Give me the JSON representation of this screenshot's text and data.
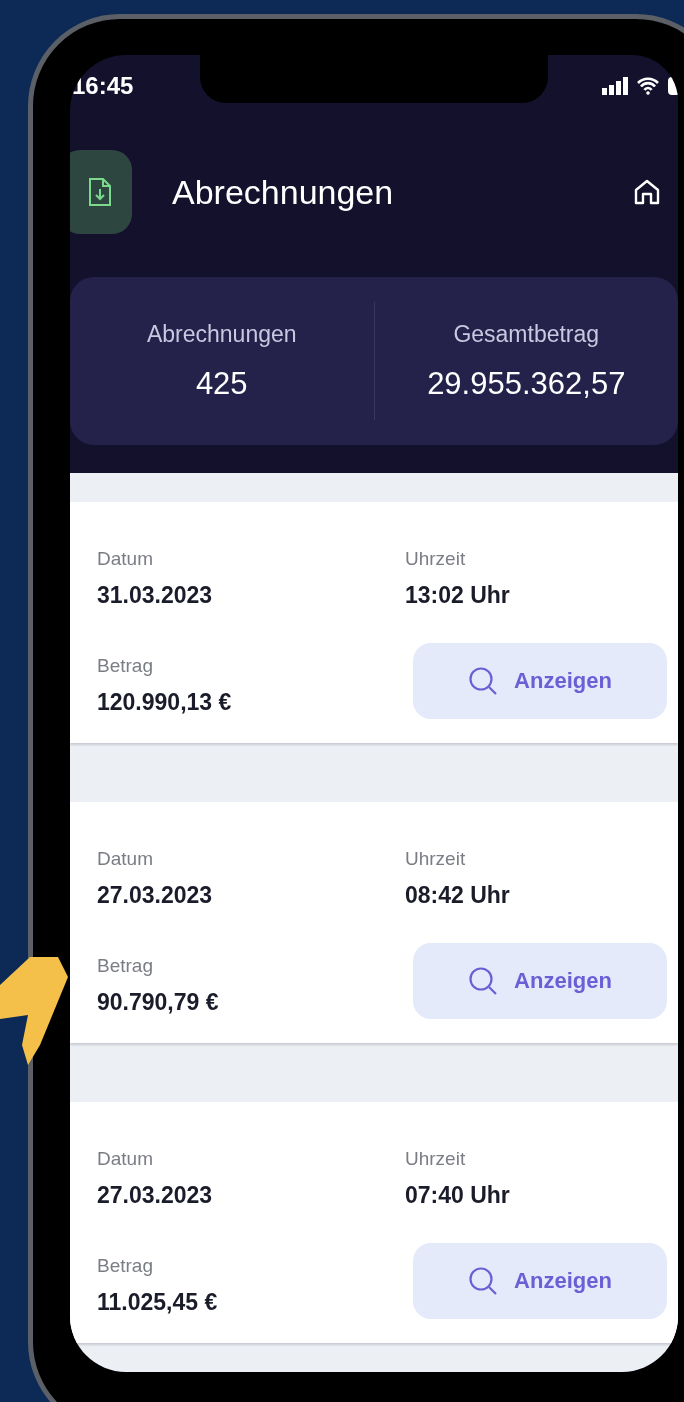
{
  "status_bar": {
    "time": "16:45"
  },
  "header": {
    "title": "Abrechnungen"
  },
  "summary": [
    {
      "label": "Abrechnungen",
      "value": "425"
    },
    {
      "label": "Gesamtbetrag",
      "value": "29.955.362,57"
    }
  ],
  "records": [
    {
      "date_label": "Datum",
      "date": "31.03.2023",
      "time_label": "Uhrzeit",
      "time": "13:02 Uhr",
      "amount_label": "Betrag",
      "amount": "120.990,13 €",
      "button": "Anzeigen"
    },
    {
      "date_label": "Datum",
      "date": "27.03.2023",
      "time_label": "Uhrzeit",
      "time": "08:42 Uhr",
      "amount_label": "Betrag",
      "amount": "90.790,79 €",
      "button": "Anzeigen"
    },
    {
      "date_label": "Datum",
      "date": "27.03.2023",
      "time_label": "Uhrzeit",
      "time": "07:40 Uhr",
      "amount_label": "Betrag",
      "amount": "11.025,45 €",
      "button": "Anzeigen"
    }
  ]
}
